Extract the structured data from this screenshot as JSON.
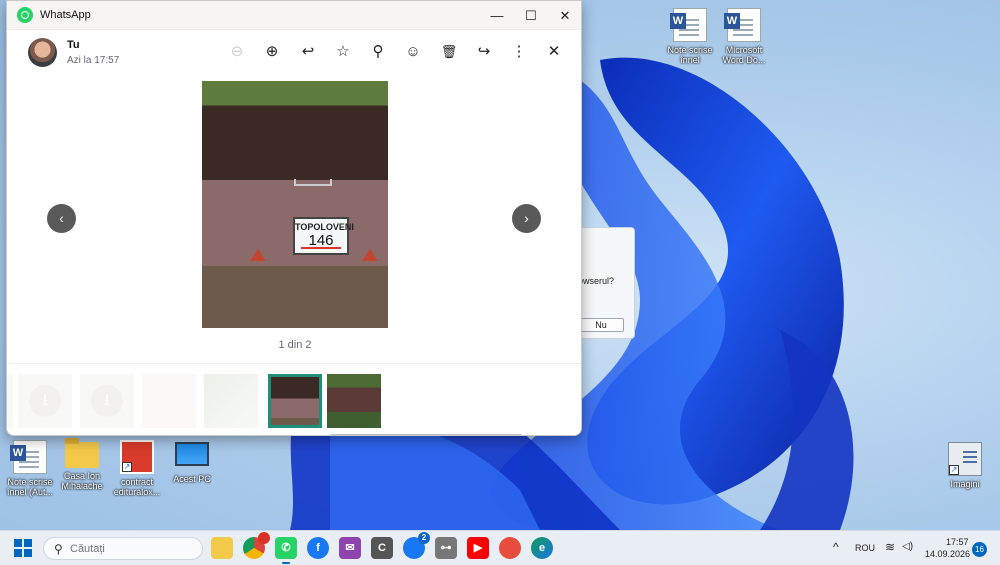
{
  "window": {
    "title": "WhatsApp",
    "minimize_glyph": "—",
    "maximize_glyph": "☐",
    "close_glyph": "✕"
  },
  "viewer": {
    "sender_name": "Tu",
    "sender_time": "Azi la 17:57",
    "tools": {
      "zoom_out": "⊖",
      "zoom_in": "⊕",
      "reply": "↩",
      "star": "☆",
      "pin": "⚲",
      "react": "☺",
      "delete": "🗑",
      "forward": "↪",
      "menu": "⋮",
      "close": "✕"
    },
    "photo_sign_line1": "TOPOLOVENI",
    "photo_sign_line2": "146",
    "prev_glyph": "‹",
    "next_glyph": "›",
    "counter": "1 din 2",
    "download_glyph": "⭳"
  },
  "background_dialog": {
    "text": "owserul?",
    "button": "Nu"
  },
  "desktop_icons": {
    "note_scrise_right": "Note scrise înnel",
    "word_right": "Microsoft Word Do...",
    "note_scrise_left": "Note scrise înnel (Aut...",
    "casa": "Casa Ion Mihalache",
    "contract": "contract edituraloх...",
    "acest_pc": "Acest PC",
    "imagini": "Imagini",
    "word_badge": "W"
  },
  "taskbar": {
    "search_placeholder": "Căutați",
    "search_glyph": "⚲",
    "apps": {
      "chrome_badge": "",
      "messenger_badge": "2",
      "whatsapp": "✆",
      "facebook": "f",
      "mail": "✉",
      "c_app": "C",
      "youtube": "▶",
      "key_app": "⊶",
      "edge": "e"
    },
    "tray_chevron": "^",
    "language": "ROU",
    "wifi": "≋",
    "volume": "◁)",
    "time": "17:57",
    "date": "14.09.2026",
    "notification_count": "16"
  },
  "colors": {
    "accent": "#1f8f7c",
    "whatsapp_green": "#25d366",
    "windows_blue": "#0067c0"
  }
}
